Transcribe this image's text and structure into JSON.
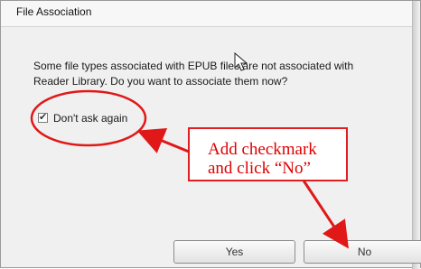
{
  "dialog": {
    "title": "File Association",
    "message_line1": "Some file types associated with EPUB files are not associated with",
    "message_line2": "Reader Library.  Do you want to associate them now?"
  },
  "checkbox": {
    "label": "Don't ask again",
    "checked": true,
    "mark": "✔"
  },
  "buttons": {
    "yes": "Yes",
    "no": "No"
  },
  "annotation": {
    "line1": "Add checkmark",
    "line2": "and click “No”",
    "color": "#e00000"
  },
  "icons": {
    "cursor": "mouse-pointer-icon"
  }
}
